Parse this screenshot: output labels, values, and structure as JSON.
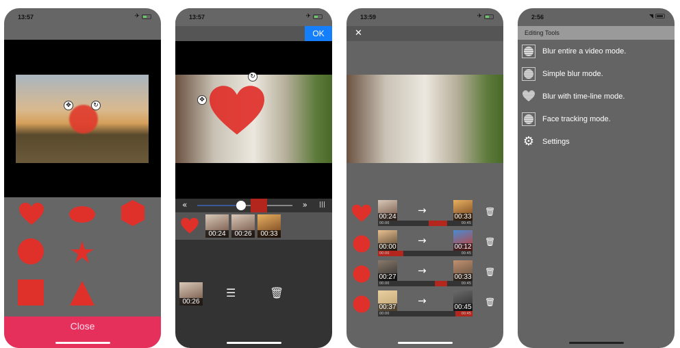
{
  "screens": [
    {
      "status": {
        "time": "13:57"
      },
      "shapes": [
        "heart",
        "ellipse",
        "hexagon",
        "circle",
        "star",
        "square",
        "triangle"
      ],
      "close_label": "Close"
    },
    {
      "status": {
        "time": "13:57"
      },
      "ok_label": "OK",
      "slider": {
        "rewind_icon": "«",
        "forward_icon": "»",
        "menu_icon": "|||",
        "value": 0.46
      },
      "thumbnails": [
        "00:24",
        "00:26",
        "00:33"
      ],
      "selected_thumbnail": "00:26"
    },
    {
      "status": {
        "time": "13:59"
      },
      "close_icon": "✕",
      "clips": [
        {
          "shape": "heart",
          "start": "00:24",
          "end": "00:33",
          "range_start_label": "00:00",
          "range_end_label": "00:45"
        },
        {
          "shape": "circle",
          "start": "00:00",
          "end": "00:12",
          "range_start_label": "00:00",
          "range_end_label": "00:45"
        },
        {
          "shape": "circle",
          "start": "00:27",
          "end": "00:33",
          "range_start_label": "00:00",
          "range_end_label": "00:45"
        },
        {
          "shape": "circle",
          "start": "00:37",
          "end": "00:45",
          "range_start_label": "00:00",
          "range_end_label": "00:45"
        }
      ]
    },
    {
      "status": {
        "time": "2:56"
      },
      "header": "Editing Tools",
      "tools": [
        {
          "label": "Blur entire a video mode.",
          "icon": "blur-disc"
        },
        {
          "label": "Simple blur mode.",
          "icon": "blur-disc"
        },
        {
          "label": "Blur with time-line mode.",
          "icon": "blur-heart"
        },
        {
          "label": "Face tracking mode.",
          "icon": "blur-disc"
        },
        {
          "label": "Settings",
          "icon": "gear"
        }
      ]
    }
  ],
  "colors": {
    "accent_red": "#e0302a",
    "close_pink": "#e6305c",
    "ok_blue": "#157efb"
  }
}
